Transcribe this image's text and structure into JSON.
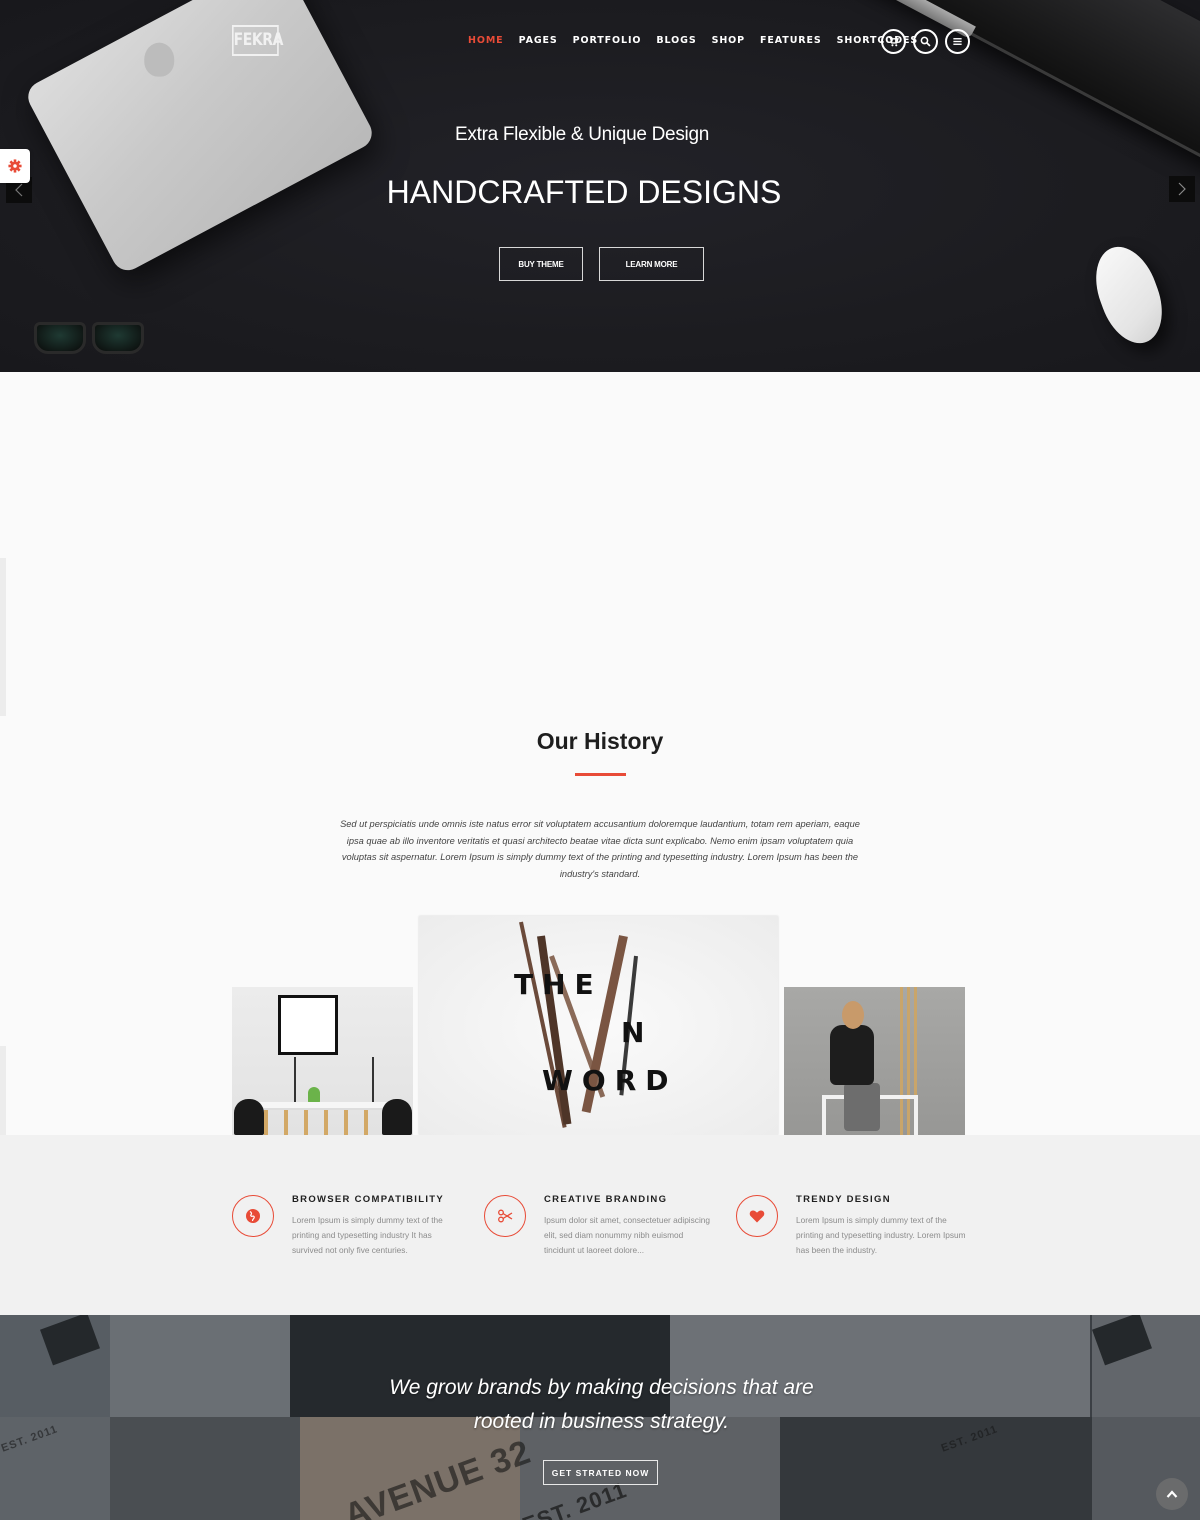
{
  "header": {
    "logo": "FEKRA",
    "nav": [
      {
        "label": "HOME",
        "active": true
      },
      {
        "label": "PAGES",
        "active": false
      },
      {
        "label": "PORTFOLIO",
        "active": false
      },
      {
        "label": "BLOGS",
        "active": false
      },
      {
        "label": "SHOP",
        "active": false
      },
      {
        "label": "FEATURES",
        "active": false
      },
      {
        "label": "SHORTCODES",
        "active": false
      }
    ],
    "icons": [
      "cart-icon",
      "search-icon",
      "menu-icon"
    ]
  },
  "hero": {
    "subtitle": "Extra Flexible & Unique Design",
    "title": "HANDCRAFTED DESIGNS",
    "buttons": {
      "buy": "BUY THEME",
      "learn": "LEARN MORE"
    }
  },
  "history": {
    "title": "Our History",
    "text": "Sed ut perspiciatis unde omnis iste natus error sit voluptatem accusantium doloremque laudantium, totam rem aperiam, eaque ipsa quae ab illo inventore veritatis et quasi architecto beatae vitae dicta sunt explicabo. Nemo enim ipsam voluptatem quia voluptas sit aspernatur. Lorem Ipsum is simply dummy text of the printing and typesetting industry. Lorem Ipsum has been the industry's standard.",
    "images": {
      "center_word": [
        "THE",
        "N",
        "WORD"
      ]
    }
  },
  "features": [
    {
      "icon": "globe-icon",
      "title": "BROWSER COMPATIBILITY",
      "text": "Lorem Ipsum is simply dummy text of the printing and typesetting industry It has survived not only five centuries."
    },
    {
      "icon": "scissors-icon",
      "title": "CREATIVE BRANDING",
      "text": "Ipsum dolor sit amet, consectetuer adipiscing elit, sed diam nonummy nibh euismod tincidunt ut laoreet dolore..."
    },
    {
      "icon": "heart-icon",
      "title": "TRENDY DESIGN",
      "text": "Lorem Ipsum is simply dummy text of the printing and typesetting industry. Lorem Ipsum has been the industry."
    }
  ],
  "cta": {
    "line1": "We grow brands by making decisions that are",
    "line2": "rooted in business strategy.",
    "button": "GET STRATED NOW",
    "background_tags": [
      "AVENUE 32",
      "EST. 2011"
    ]
  },
  "colors": {
    "accent": "#e84b37",
    "hero_bg": "#1c1c20",
    "features_bg": "#f1f1f1"
  }
}
